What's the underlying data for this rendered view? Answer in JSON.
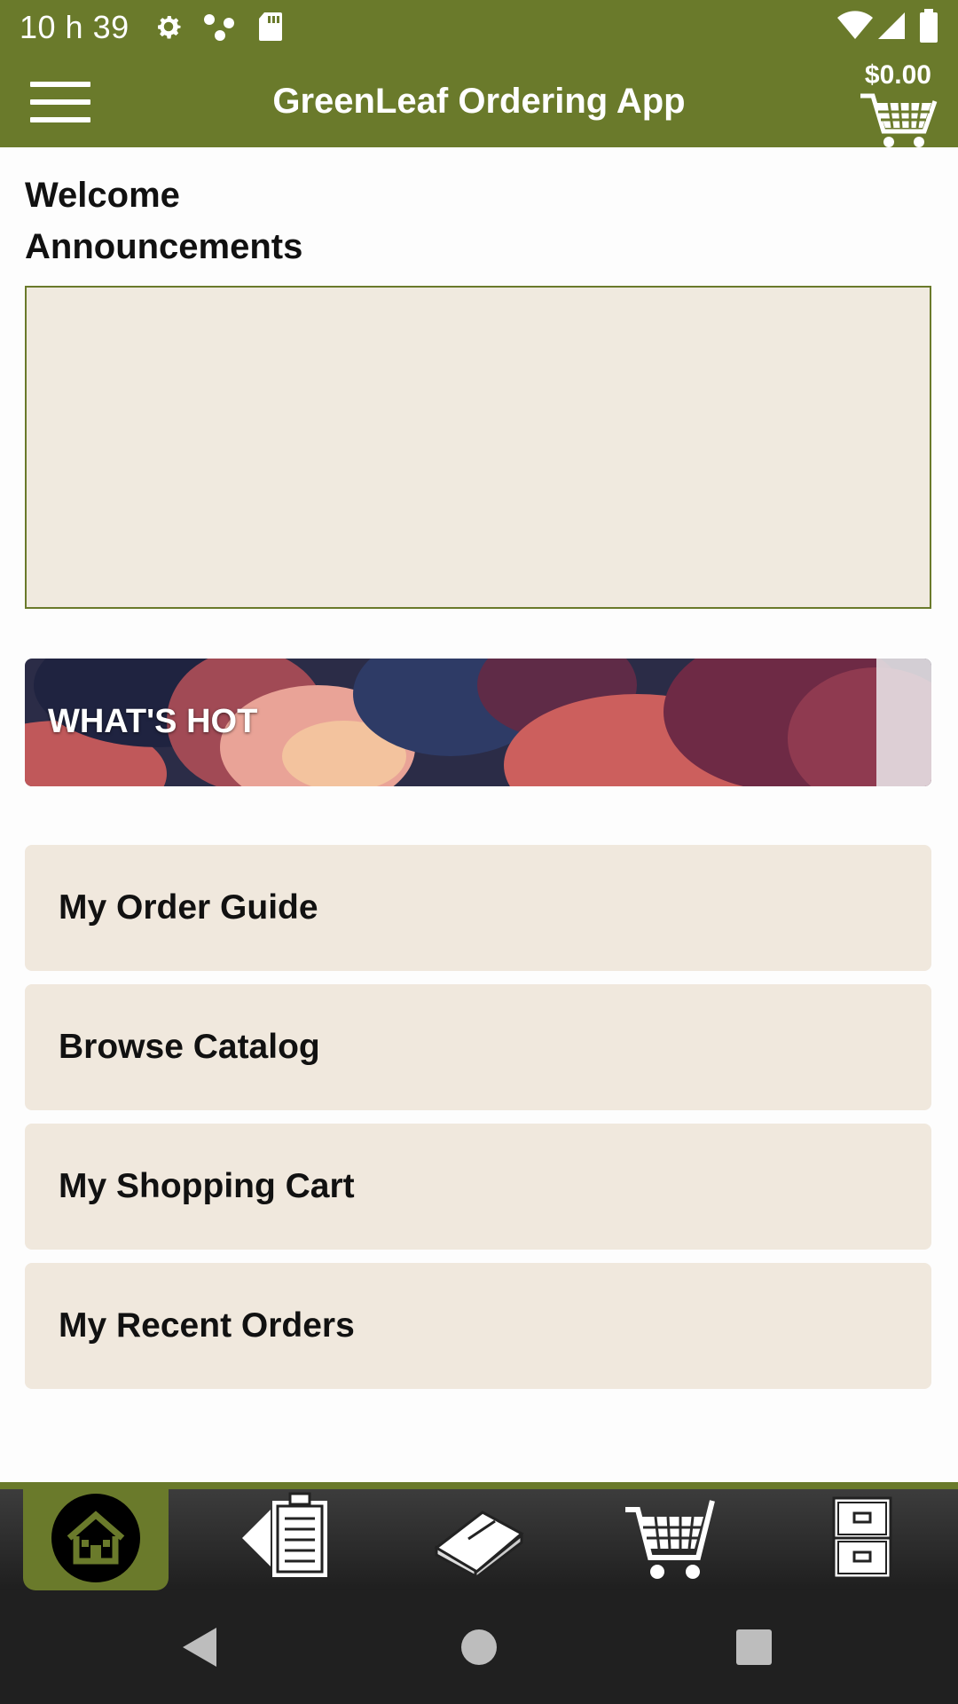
{
  "status_bar": {
    "time": "10 h 39",
    "icons": [
      "gear-icon",
      "network-dots-icon",
      "sd-card-icon",
      "wifi-icon",
      "signal-icon",
      "battery-icon"
    ]
  },
  "app_bar": {
    "title": "GreenLeaf Ordering App",
    "cart_total": "$0.00",
    "icons": [
      "hamburger-menu-icon",
      "shopping-cart-icon"
    ]
  },
  "content": {
    "welcome": "Welcome",
    "announcements_heading": "Announcements",
    "banner_label": "WHAT'S HOT",
    "menu_items": [
      {
        "label": "My Order Guide"
      },
      {
        "label": "Browse Catalog"
      },
      {
        "label": "My Shopping Cart"
      },
      {
        "label": "My Recent Orders"
      }
    ]
  },
  "tab_bar": {
    "tabs": [
      {
        "icon": "home-icon",
        "active": true
      },
      {
        "icon": "order-guide-icon",
        "active": false
      },
      {
        "icon": "catalog-book-icon",
        "active": false
      },
      {
        "icon": "cart-icon",
        "active": false
      },
      {
        "icon": "file-cabinet-icon",
        "active": false
      }
    ]
  },
  "nav_bar": {
    "buttons": [
      "back-icon",
      "home-circle-icon",
      "recents-icon"
    ]
  },
  "colors": {
    "brand_green": "#6a7a2b",
    "card_beige": "#f0e8dd",
    "tab_bar_dark": "#2a2a2a"
  }
}
